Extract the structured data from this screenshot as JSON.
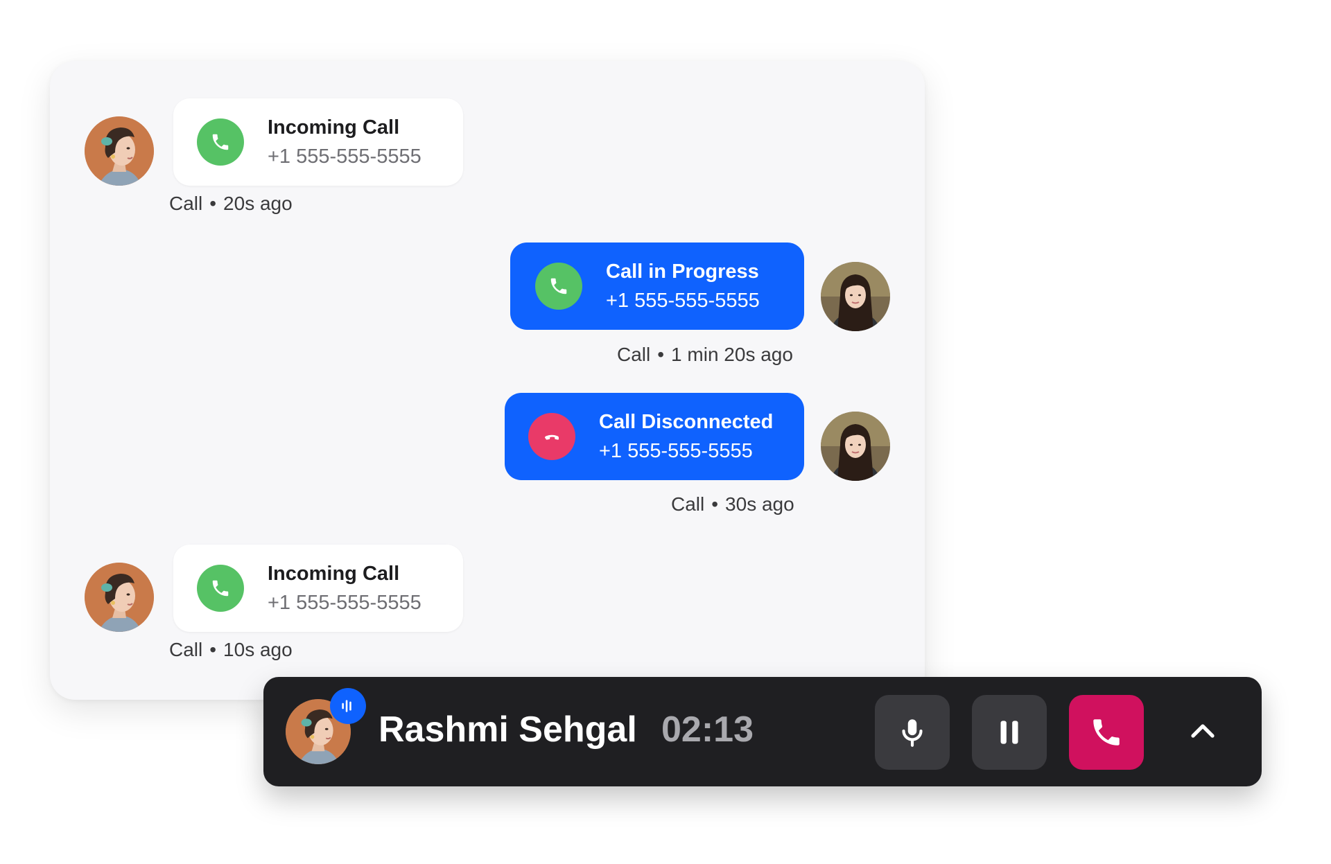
{
  "colors": {
    "panel_bg": "#f7f7f9",
    "incoming_bubble": "#ffffff",
    "outgoing_bubble": "#0f62fe",
    "call_green": "#56c265",
    "call_red": "#e93a68",
    "callbar_bg": "#1f1f22",
    "end_call": "#d0115e"
  },
  "messages": [
    {
      "direction": "incoming",
      "icon": "phone-icon",
      "title": "Incoming Call",
      "number": "+1 555-555-5555",
      "meta_type": "Call",
      "meta_time": "20s ago"
    },
    {
      "direction": "outgoing",
      "icon": "phone-icon",
      "title": "Call in Progress",
      "number": "+1 555-555-5555",
      "meta_type": "Call",
      "meta_time": "1 min 20s ago"
    },
    {
      "direction": "outgoing",
      "icon": "hang-up-icon",
      "title": "Call Disconnected",
      "number": "+1 555-555-5555",
      "meta_type": "Call",
      "meta_time": "30s ago"
    },
    {
      "direction": "incoming",
      "icon": "phone-icon",
      "title": "Incoming Call",
      "number": "+1 555-555-5555",
      "meta_type": "Call",
      "meta_time": "10s ago"
    }
  ],
  "meta_separator": "•",
  "callbar": {
    "caller_name": "Rashmi Sehgal",
    "timer": "02:13",
    "speaking_icon": "audio-wave-icon",
    "buttons": [
      "microphone-icon",
      "pause-icon",
      "end-call-icon",
      "chevron-up-icon"
    ]
  }
}
